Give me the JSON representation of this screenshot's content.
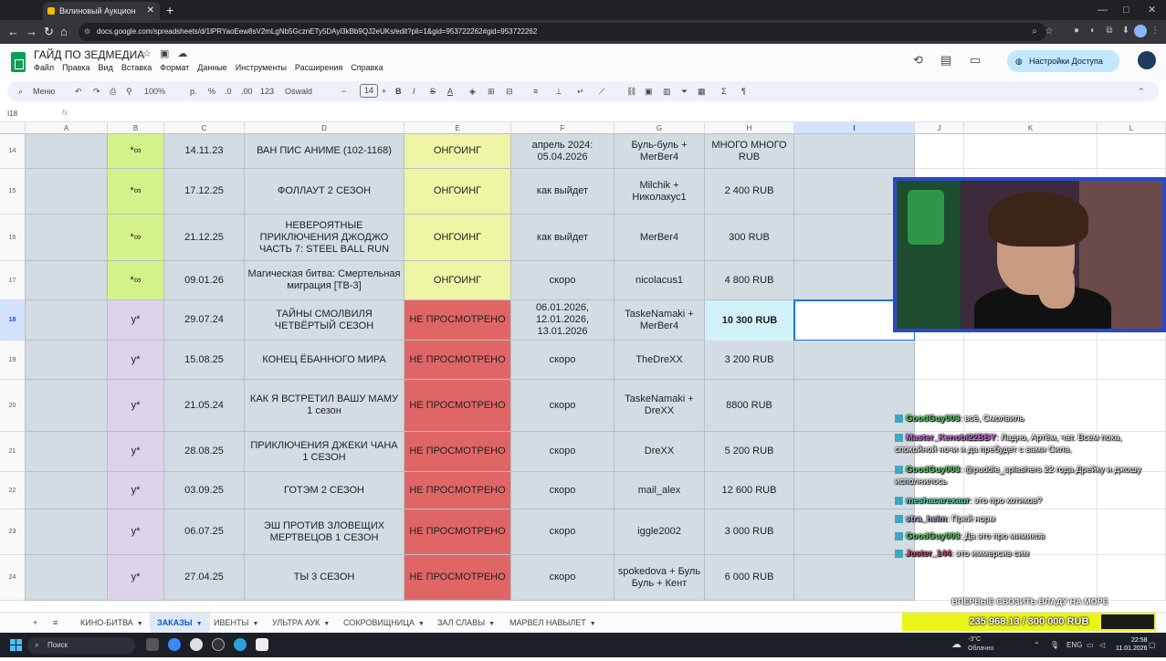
{
  "browser": {
    "tab_title": "Вклиновый Аукцион",
    "url": "docs.google.com/spreadsheets/d/1lPRYaoEew8sV2mLgNb5GcznETy5DAyl3kBb9QJ2eUKs/edit?pli=1&gid=953722262#gid=953722262"
  },
  "doc": {
    "title": "ГАЙД ПО ЗЕДМЕДИА",
    "menu": [
      "Файл",
      "Правка",
      "Вид",
      "Вставка",
      "Формат",
      "Данные",
      "Инструменты",
      "Расширения",
      "Справка"
    ],
    "share_label": "Настройки Доступа"
  },
  "toolbar": {
    "menu_label": "Меню",
    "zoom": "100%",
    "currency": "р.",
    "percent": "%",
    "dec_less": ".0",
    "dec_more": ".00",
    "number_fmt": "123",
    "font_name": "Oswald",
    "font_size": "14"
  },
  "formula": {
    "namebox": "I18",
    "fx": "fx"
  },
  "columns": [
    "A",
    "B",
    "C",
    "D",
    "E",
    "F",
    "G",
    "H",
    "I",
    "J",
    "K",
    "L"
  ],
  "selected_column": "I",
  "rows": [
    {
      "num": "14",
      "b": "*∞",
      "c": "14.11.23",
      "d": "ВАН ПИС АНИМЕ (102-1168)",
      "e": "ОНГОИНГ",
      "f": "апрель 2024: 05.04.2026",
      "g": "Буль-буль + MerBer4",
      "h": "МНОГО МНОГО RUB",
      "b_bg": "green",
      "e_bg": "yellow"
    },
    {
      "num": "15",
      "b": "*∞",
      "c": "17.12.25",
      "d": "ФОЛЛАУТ 2 СЕЗОН",
      "e": "ОНГОИНГ",
      "f": "как выйдет",
      "g": "Milchik + Николакус1",
      "h": "2 400 RUB",
      "b_bg": "green",
      "e_bg": "yellow"
    },
    {
      "num": "16",
      "b": "*∞",
      "c": "21.12.25",
      "d": "НЕВЕРОЯТНЫЕ ПРИКЛЮЧЕНИЯ ДЖОДЖО ЧАСТЬ 7: STEEL BALL RUN",
      "e": "ОНГОИНГ",
      "f": "как выйдет",
      "g": "MerBer4",
      "h": "300 RUB",
      "b_bg": "green",
      "e_bg": "yellow"
    },
    {
      "num": "17",
      "b": "*∞",
      "c": "09.01.26",
      "d": "Магическая битва: Смертельная миграция [ТВ-3]",
      "e": "ОНГОИНГ",
      "f": "скоро",
      "g": "nicolacus1",
      "h": "4 800 RUB",
      "b_bg": "green",
      "e_bg": "yellow"
    },
    {
      "num": "18",
      "b": "у*",
      "c": "29.07.24",
      "d": "ТАЙНЫ СМОЛВИЛЯ ЧЕТВЁРТЫЙ СЕЗОН",
      "e": "НЕ ПРОСМОТРЕНО",
      "f": "06.01.2026, 12.01.2026, 13.01.2026",
      "g": "TaskeNamaki + MerBer4",
      "h": "10 300 RUB",
      "b_bg": "purple",
      "e_bg": "red"
    },
    {
      "num": "19",
      "b": "у*",
      "c": "15.08.25",
      "d": "КОНЕЦ ЁБАННОГО МИРА",
      "e": "НЕ ПРОСМОТРЕНО",
      "f": "скоро",
      "g": "TheDreXX",
      "h": "3 200 RUB",
      "b_bg": "purple",
      "e_bg": "red"
    },
    {
      "num": "20",
      "b": "у*",
      "c": "21.05.24",
      "d": "КАК Я ВСТРЕТИЛ ВАШУ МАМУ 1 сезон",
      "e": "НЕ ПРОСМОТРЕНО",
      "f": "скоро",
      "g": "TaskeNamaki + DreXX",
      "h": "8800 RUB",
      "b_bg": "purple",
      "e_bg": "red"
    },
    {
      "num": "21",
      "b": "у*",
      "c": "28.08.25",
      "d": "ПРИКЛЮЧЕНИЯ ДЖЕКИ ЧАНА 1 СЕЗОН",
      "e": "НЕ ПРОСМОТРЕНО",
      "f": "скоро",
      "g": "DreXX",
      "h": "5 200 RUB",
      "b_bg": "purple",
      "e_bg": "red"
    },
    {
      "num": "22",
      "b": "у*",
      "c": "03.09.25",
      "d": "ГОТЭМ 2 СЕЗОН",
      "e": "НЕ ПРОСМОТРЕНО",
      "f": "скоро",
      "g": "mail_alex",
      "h": "12 600 RUB",
      "b_bg": "purple",
      "e_bg": "red"
    },
    {
      "num": "23",
      "b": "у*",
      "c": "06.07.25",
      "d": "ЭШ ПРОТИВ ЗЛОВЕЩИХ МЕРТВЕЦОВ 1 СЕЗОН",
      "e": "НЕ ПРОСМОТРЕНО",
      "f": "скоро",
      "g": "iggle2002",
      "h": "3 000 RUB",
      "b_bg": "purple",
      "e_bg": "red"
    },
    {
      "num": "24",
      "b": "у*",
      "c": "27.04.25",
      "d": "ТЫ 3 СЕЗОН",
      "e": "НЕ ПРОСМОТРЕНО",
      "f": "скоро",
      "g": "spokedova + Буль Буль + Кент",
      "h": "6 000 RUB",
      "b_bg": "purple",
      "e_bg": "red"
    }
  ],
  "chat": [
    {
      "user": "GoodGuy003",
      "user_color": "#5bd66b",
      "text": ": всё, Смолвиль"
    },
    {
      "user": "Master_Kenobi22BBY",
      "user_color": "#c86bd6",
      "text": ": Ладно, Артём, чат. Всем пока, спокойной ночи и да пребудет с вами Сила."
    },
    {
      "user": "GoodGuy003",
      "user_color": "#5bd66b",
      "text": ": @puddle_splashers 22 года Дрейку и джошу исполнилось"
    },
    {
      "user": "meshacarexaur",
      "user_color": "#5bd6b6",
      "text": ": это про котиков?"
    },
    {
      "user": "stra_helm",
      "user_color": "#b0b0d0",
      "text": ": Прей норм"
    },
    {
      "user": "GoodGuy003",
      "user_color": "#5bd66b",
      "text": ": Да это про мимиков"
    },
    {
      "user": "Juster_144",
      "user_color": "#d6405b",
      "text": ": это иммерсив сим"
    }
  ],
  "sheet_tabs": [
    "КИНО-БИТВА",
    "ЗАКАЗЫ",
    "ИВЕНТЫ",
    "УЛЬТРА АУК",
    "СОКРОВИЩНИЦА",
    "ЗАЛ СЛАВЫ",
    "МАРВЕЛ НАВЫЛЕТ"
  ],
  "active_tab": "ЗАКАЗЫ",
  "overlay": {
    "banner": "ВПЕРВЫЕ СВОЗИТЬ ВЛАДУ НА МОРЕ",
    "donate_text": "235 968.13 / 300 000 RUB",
    "donate_progress": 0.7866
  },
  "taskbar": {
    "search": "Поиск",
    "weather_temp": "-3°C",
    "weather_desc": "Облачно",
    "lang": "ENG",
    "time": "22:58",
    "date": "11.01.2026"
  },
  "colors": {
    "green": "#d4f28a",
    "purple": "#ddd3eb",
    "yellow": "#eef5a5",
    "red": "#e06666",
    "cyan": "#d2f2fa",
    "accent": "#0b57d0"
  }
}
